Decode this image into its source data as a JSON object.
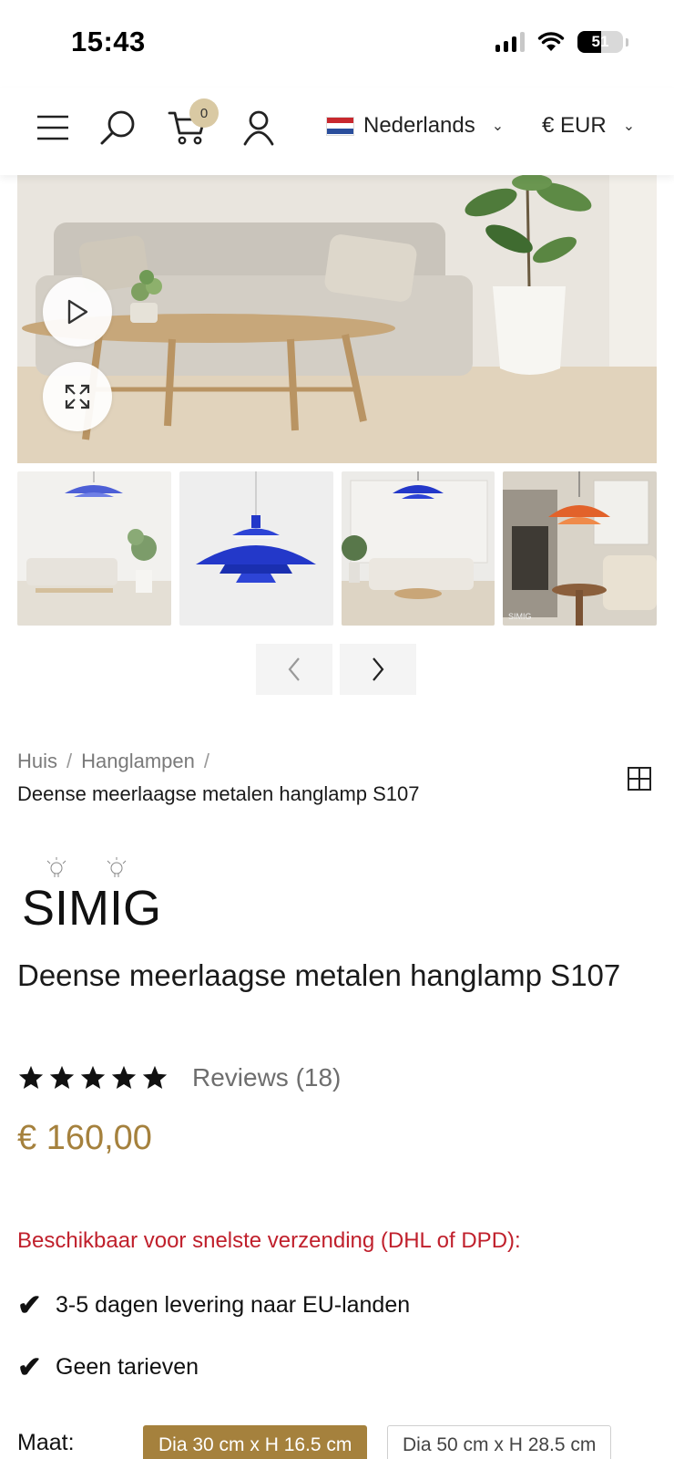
{
  "status_bar": {
    "time": "15:43",
    "battery": "51"
  },
  "header": {
    "cart_count": "0",
    "language": "Nederlands",
    "currency": "€ EUR"
  },
  "gallery": {
    "thumbnail_count": 4,
    "thumb4_watermark": "SIMIG"
  },
  "breadcrumb": {
    "items": [
      "Huis",
      "Hanglampen"
    ],
    "separator": "/",
    "current": "Deense meerlaagse metalen hanglamp S107"
  },
  "brand": {
    "logo_text": "SIMIG"
  },
  "product": {
    "title": "Deense meerlaagse metalen hanglamp S107",
    "rating": 5,
    "reviews_label": "Reviews (18)",
    "price": "€ 160,00"
  },
  "shipping": {
    "headline": "Beschikbaar voor snelste verzending (DHL of DPD):",
    "checks": [
      "3-5 dagen levering naar EU-landen",
      "Geen tarieven"
    ]
  },
  "size": {
    "label": "Maat:",
    "options": [
      "Dia 30 cm x H 16.5 cm",
      "Dia 50 cm x H 28.5 cm"
    ],
    "selected": "Dia 30 cm x H 16.5 cm"
  },
  "colors": {
    "accent_gold": "#a5813d",
    "alert_red": "#c0202c",
    "cart_badge": "#d9c9a3",
    "lamp_blue": "#2338c9",
    "lamp_orange": "#e2622a"
  }
}
